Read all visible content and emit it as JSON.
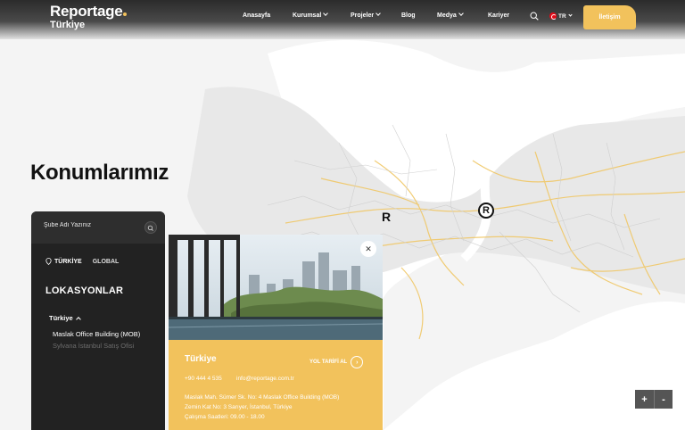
{
  "header": {
    "logo_main": "Reportage",
    "logo_sub": "Türkiye",
    "nav": [
      {
        "label": "Anasayfa",
        "has_dropdown": false
      },
      {
        "label": "Kurumsal",
        "has_dropdown": true
      },
      {
        "label": "Projeler",
        "has_dropdown": true
      },
      {
        "label": "Blog",
        "has_dropdown": false
      },
      {
        "label": "Medya",
        "has_dropdown": true
      },
      {
        "label": "Kariyer",
        "has_dropdown": false
      }
    ],
    "language": "TR",
    "contact_label": "İletişim"
  },
  "page_title": "Konumlarımız",
  "panel": {
    "search_placeholder": "Şube Adı Yazınız",
    "tabs": [
      {
        "label": "TÜRKİYE",
        "active": true
      },
      {
        "label": "GLOBAL",
        "active": false
      }
    ],
    "title": "LOKASYONLAR",
    "country": "Türkiye",
    "locations": [
      {
        "label": "Maslak Office Building (MOB)",
        "active": true
      },
      {
        "label": "Sylvana İstanbul Satış Ofisi",
        "active": false
      }
    ]
  },
  "card": {
    "title": "Türkiye",
    "route_label": "YOL TARİFİ AL",
    "phone": "+90 444 4 535",
    "email": "info@reportage.com.tr",
    "address_lines": [
      "Maslak Mah. Sümer Sk. No: 4 Maslak Office Building (MOB)",
      "Zemin Kat No: 3 Sarıyer, İstanbul, Türkiye",
      "Çalışma Saatleri: 09.00 - 18.00"
    ]
  },
  "map": {
    "markers": [
      "R",
      "R"
    ]
  },
  "zoom": {
    "in": "+",
    "out": "-"
  },
  "colors": {
    "accent": "#f2c25c",
    "header_dark": "#2b2b2b",
    "panel_dark": "#222222",
    "road": "#f0c766"
  },
  "icons": {
    "search": "search-icon",
    "flag": "turkey-flag-icon",
    "close": "close-icon",
    "route": "chevron-right-icon",
    "tab": "location-pin-icon"
  }
}
